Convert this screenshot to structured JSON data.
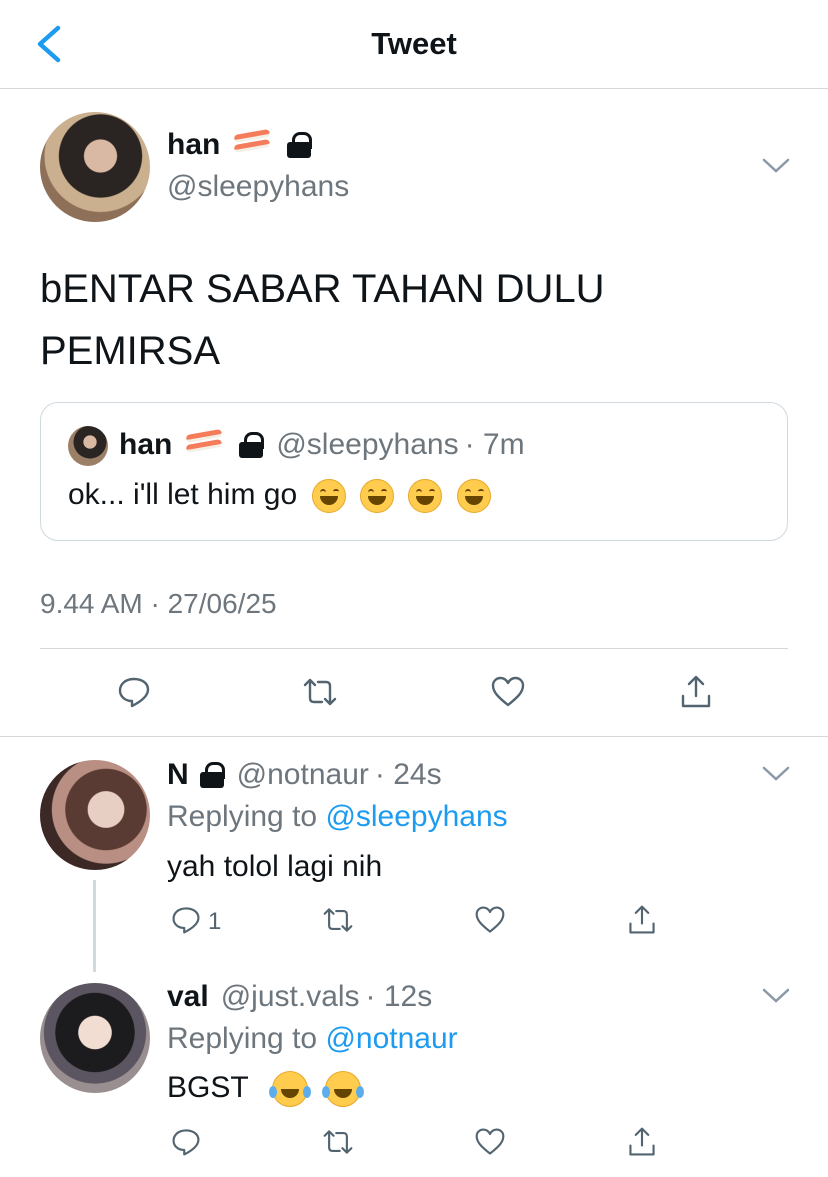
{
  "header": {
    "title": "Tweet"
  },
  "tweet": {
    "name": "han",
    "handle": "@sleepyhans",
    "text_line1": "bENTAR SABAR TAHAN DULU",
    "text_line2": "PEMIRSA",
    "quote": {
      "name": "han",
      "handle": "@sleepyhans",
      "time": "· 7m",
      "text": "ok... i'll let him go"
    },
    "timestamp": "9.44 AM · 27/06/25"
  },
  "replies": [
    {
      "name": "N",
      "handle": "@notnaur",
      "time": "· 24s",
      "replying_label": "Replying to",
      "replying_handle": "@sleepyhans",
      "text": "yah tolol lagi nih",
      "reply_count": "1"
    },
    {
      "name": "val",
      "handle": "@just.vals",
      "time": "· 12s",
      "replying_label": "Replying to",
      "replying_handle": "@notnaur",
      "text": "BGST"
    }
  ],
  "colors": {
    "link": "#1d9bf0",
    "muted": "#6e767d",
    "divider": "#d6d9dc"
  },
  "icons": [
    "back-arrow-icon",
    "sushi-emoji-icon",
    "lock-icon",
    "chevron-down-icon",
    "reply-icon",
    "retweet-icon",
    "like-icon",
    "share-icon",
    "grin-emoji-icon",
    "laugh-cry-emoji-icon"
  ]
}
